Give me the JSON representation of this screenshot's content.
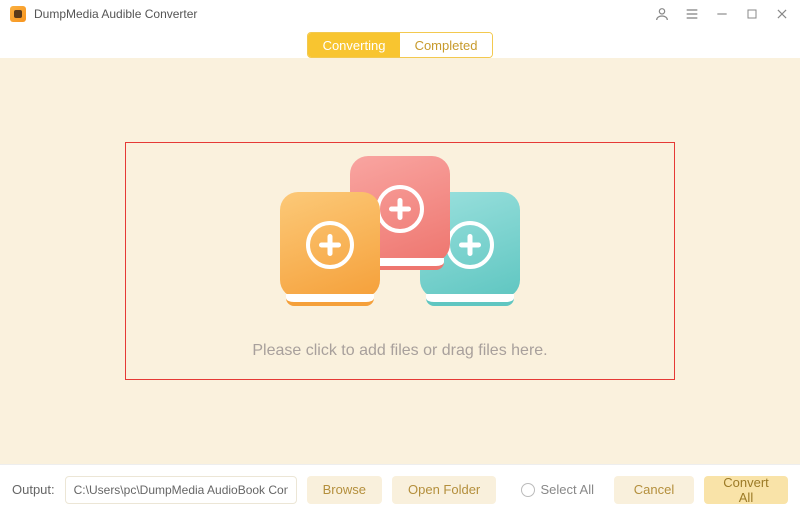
{
  "app": {
    "title": "DumpMedia Audible Converter"
  },
  "tabs": {
    "converting": "Converting",
    "completed": "Completed"
  },
  "dropzone": {
    "text": "Please click to add files or drag files here."
  },
  "footer": {
    "output_label": "Output:",
    "output_path": "C:\\Users\\pc\\DumpMedia AudioBook Converte",
    "browse": "Browse",
    "open_folder": "Open Folder",
    "select_all": "Select All",
    "cancel": "Cancel",
    "convert_all": "Convert All"
  }
}
